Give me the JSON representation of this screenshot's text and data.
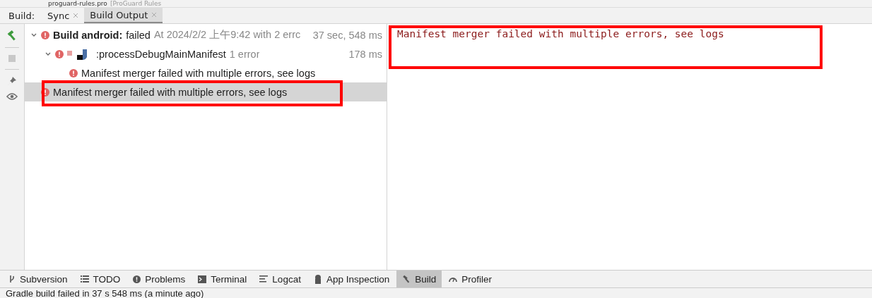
{
  "editor_tab": {
    "file": "proguard-rules.pro",
    "kind_label": "[ProGuard Rules"
  },
  "build_panel": {
    "label": "Build:",
    "tabs": [
      {
        "label": "Sync",
        "selected": false
      },
      {
        "label": "Build Output",
        "selected": true
      }
    ]
  },
  "tree": [
    {
      "title": "Build android:",
      "status": "failed",
      "detail": "At 2024/2/2 上午9:42 with 2 errc",
      "time": "37 sec, 548 ms",
      "expanded": true,
      "selected": false,
      "children": [
        {
          "title": ":processDebugMainManifest",
          "detail": "1 error",
          "time": "178 ms",
          "expanded": true,
          "selected": false,
          "children": [
            {
              "title": "Manifest merger failed with multiple errors, see logs",
              "selected": false
            }
          ]
        }
      ]
    },
    {
      "title": "Manifest merger failed with multiple errors, see logs",
      "selected": true,
      "highlighted": true
    }
  ],
  "console": {
    "text": "Manifest merger failed with multiple errors, see logs",
    "highlighted": true
  },
  "tool_windows": [
    {
      "label": "Subversion",
      "kind": "branch",
      "selected": false
    },
    {
      "label": "TODO",
      "kind": "list",
      "selected": false
    },
    {
      "label": "Problems",
      "kind": "alert",
      "selected": false
    },
    {
      "label": "Terminal",
      "kind": "terminal",
      "selected": false
    },
    {
      "label": "Logcat",
      "kind": "lines",
      "selected": false
    },
    {
      "label": "App Inspection",
      "kind": "bot",
      "selected": false
    },
    {
      "label": "Build",
      "kind": "hammer",
      "selected": true
    },
    {
      "label": "Profiler",
      "kind": "gauge",
      "selected": false
    }
  ],
  "status_bar": "Gradle build failed in 37 s 548 ms (a minute ago)"
}
